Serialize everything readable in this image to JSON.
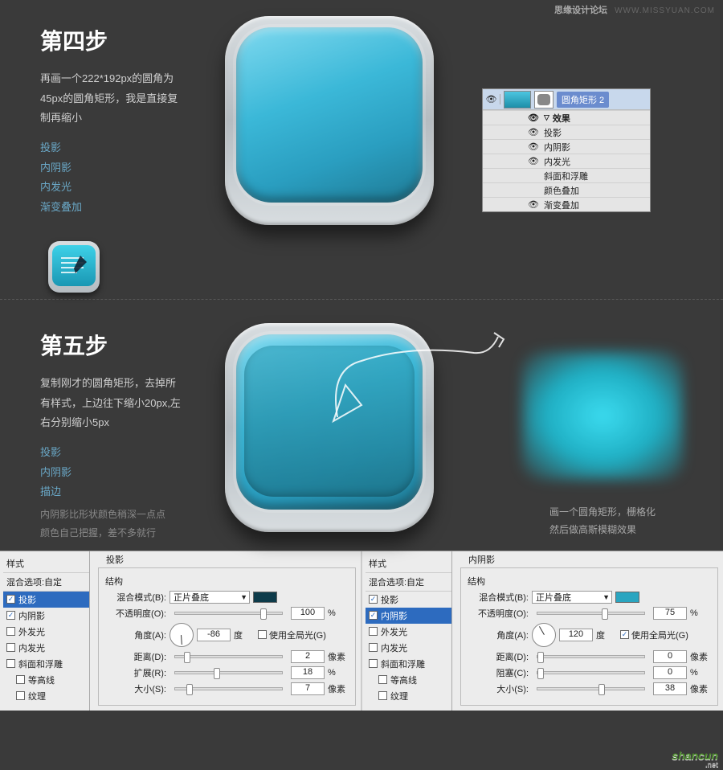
{
  "header": {
    "forum": "思缘设计论坛",
    "url": "WWW.MISSYUAN.COM"
  },
  "step4": {
    "title": "第四步",
    "desc": "再画一个222*192px的圆角为45px的圆角矩形，我是直接复制再缩小",
    "fx": [
      "投影",
      "内阴影",
      "内发光",
      "渐变叠加"
    ]
  },
  "layers": {
    "layerName": "圆角矩形 2",
    "rows": [
      {
        "label": "效果",
        "head": true
      },
      {
        "label": "投影"
      },
      {
        "label": "内阴影"
      },
      {
        "label": "内发光"
      },
      {
        "label": "斜面和浮雕",
        "noeye": true
      },
      {
        "label": "颜色叠加",
        "noeye": true
      },
      {
        "label": "渐变叠加"
      }
    ]
  },
  "step5": {
    "title": "第五步",
    "desc": "复制刚才的圆角矩形，去掉所有样式，上边往下缩小20px,左右分别缩小5px",
    "fx": [
      "投影",
      "内阴影",
      "描边"
    ],
    "note": "内阴影比形状颜色稍深一点点\n颜色自己把握，差不多就行",
    "hint": "画一个圆角矩形，栅格化\n然后做高斯模糊效果"
  },
  "dialog_labels": {
    "styles_hd": "样式",
    "struct_hd": "结构",
    "blend": "混合选项:自定",
    "mode": "混合模式(B):",
    "opacity": "不透明度(O):",
    "angle": "角度(A):",
    "degree": "度",
    "global": "使用全局光(G)",
    "distance": "距离(D):",
    "spread": "扩展(R):",
    "choke": "阻塞(C):",
    "size": "大小(S):",
    "pixel": "像素",
    "percent": "%"
  },
  "style_items": [
    "投影",
    "内阴影",
    "外发光",
    "内发光",
    "斜面和浮雕",
    "等高线",
    "纹理"
  ],
  "dialog1": {
    "title": "投影",
    "selectedIndex": 0,
    "checked": [
      true,
      true,
      false,
      false,
      false,
      false,
      false
    ],
    "mode_value": "正片叠底",
    "swatch": "#0d3b4a",
    "opacity": 100,
    "angle": -86,
    "global": false,
    "distance": 2,
    "spread": 18,
    "size": 7,
    "spread_label": "扩展(R):",
    "size_unit": "像素"
  },
  "dialog2": {
    "title": "内阴影",
    "selectedIndex": 1,
    "checked": [
      true,
      true,
      false,
      false,
      false,
      false,
      false
    ],
    "mode_value": "正片叠底",
    "swatch": "#2aa5c0",
    "opacity": 75,
    "angle": 120,
    "global": true,
    "distance": 0,
    "spread": 0,
    "size": 38,
    "spread_label": "阻塞(C):",
    "size_unit": "像素"
  },
  "watermark": {
    "text": "shancun",
    "ext": ".net"
  }
}
